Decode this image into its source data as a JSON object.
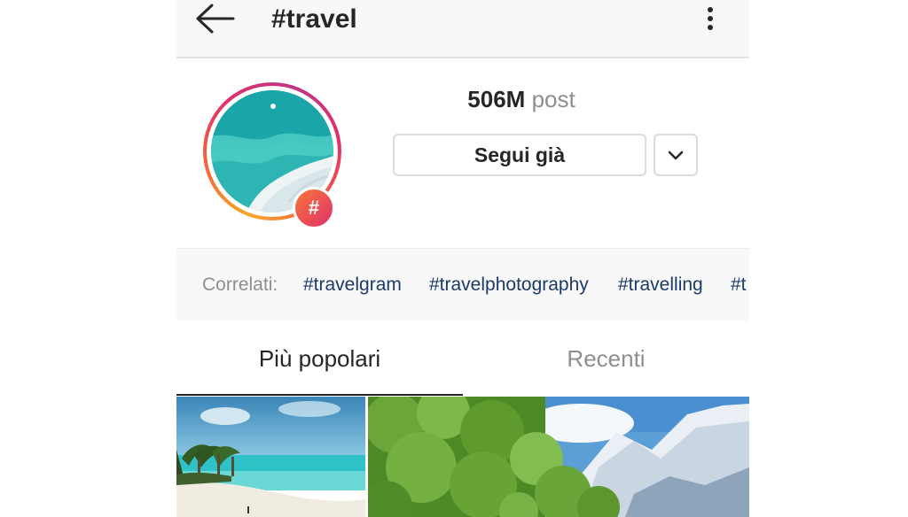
{
  "header": {
    "title": "#travel",
    "back_icon": "arrow-left-icon",
    "more_icon": "more-vertical-icon"
  },
  "profile": {
    "post_count": "506M",
    "post_label": "post",
    "follow_label": "Segui già",
    "dropdown_icon": "chevron-down-icon",
    "badge_symbol": "#"
  },
  "related": {
    "label": "Correlati:",
    "tags": [
      "#travelgram",
      "#travelphotography",
      "#travelling",
      "#t"
    ]
  },
  "tabs": [
    {
      "label": "Più popolari",
      "active": true
    },
    {
      "label": "Recenti",
      "active": false
    }
  ],
  "colors": {
    "tag_text": "#1b3a6b",
    "muted_text": "#8e8e8e",
    "ring_gradient": [
      "#f9a826",
      "#f56040",
      "#e1306c",
      "#c13584"
    ]
  }
}
